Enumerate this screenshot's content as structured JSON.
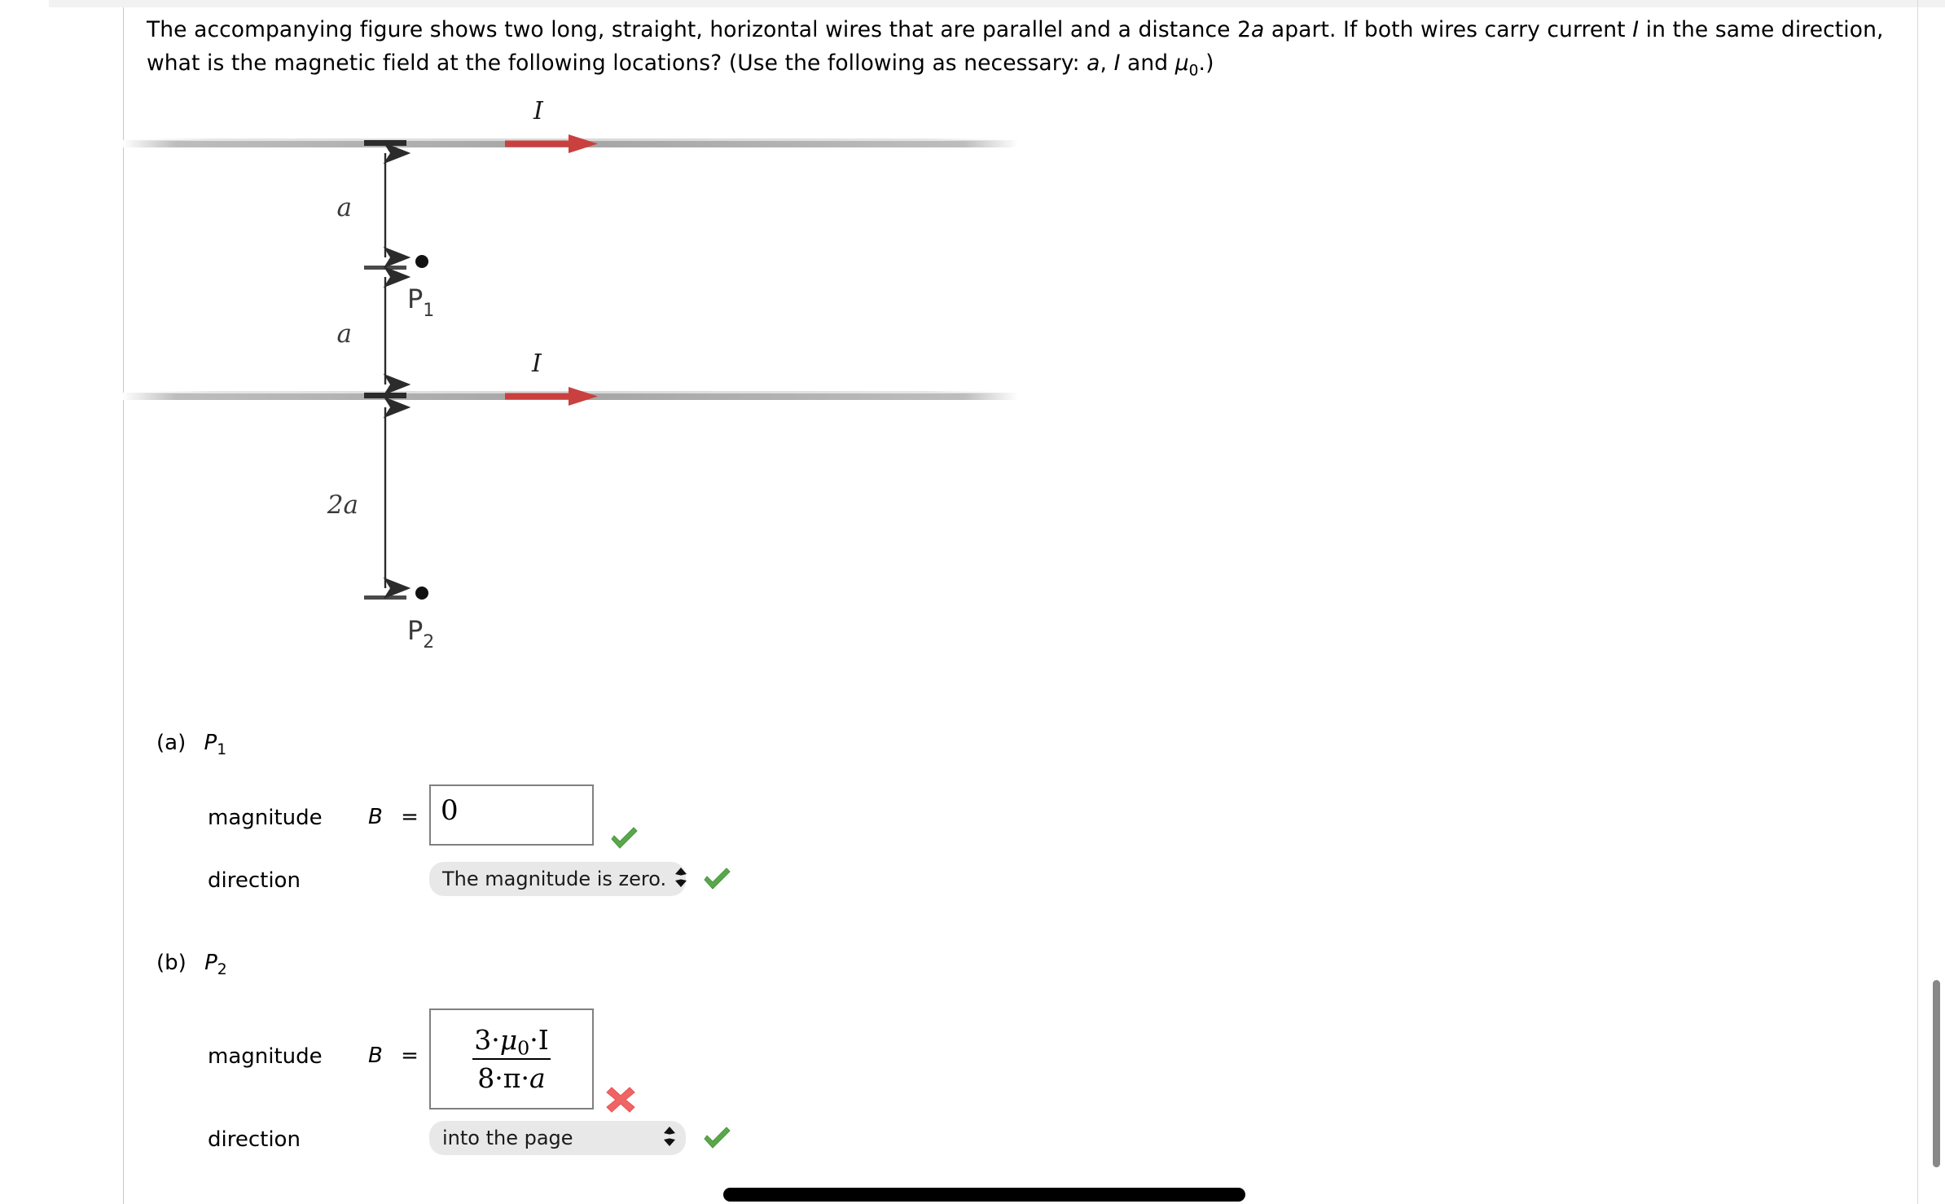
{
  "question": {
    "line1_a": "The accompanying figure shows two long, straight, horizontal wires that are parallel and a distance 2",
    "line1_b": "a",
    "line1_c": " apart. If both wires carry current ",
    "line1_d": "I",
    "line1_e": " in the same direction,",
    "line2_a": "what is the magnetic field at the following locations? (Use the following as necessary: ",
    "line2_b": "a",
    "line2_c": ", ",
    "line2_d": "I",
    "line2_e": " and ",
    "line2_mu": "μ",
    "line2_mu_sub": "0",
    "line2_f": ".)"
  },
  "figure": {
    "current_label_top": "I",
    "current_label_bottom": "I",
    "dim_a_top": "a",
    "dim_a_bottom": "a",
    "dim_2a": "2a",
    "point1_label": "P",
    "point1_sub": "1",
    "point2_label": "P",
    "point2_sub": "2",
    "wire_color": "#a8a8a8",
    "arrow_color": "#c9403f",
    "dim_line_color": "#3a3a3a"
  },
  "parts": [
    {
      "tag": "(a)",
      "point": "P",
      "point_sub": "1",
      "magnitude_label": "magnitude",
      "b_symbol": "B",
      "equals": "=",
      "answer_type": "plain",
      "answer_value": "0",
      "magnitude_status": "correct",
      "direction_label": "direction",
      "direction_value": "The magnitude is zero.",
      "direction_status": "correct"
    },
    {
      "tag": "(b)",
      "point": "P",
      "point_sub": "2",
      "magnitude_label": "magnitude",
      "b_symbol": "B",
      "equals": "=",
      "answer_type": "fraction",
      "answer_numerator": "3 · μ₀ · I",
      "answer_denominator": "8 · π · a",
      "num_parts": {
        "c1": "3",
        "dot1": "·",
        "mu": "μ",
        "mu_sub": "0",
        "dot2": "·",
        "cur": "I"
      },
      "den_parts": {
        "c1": "8",
        "dot1": "·",
        "pi": "π",
        "dot2": "·",
        "a": "a"
      },
      "magnitude_status": "incorrect",
      "direction_label": "direction",
      "direction_value": "into the page",
      "direction_status": "correct"
    }
  ],
  "icons": {
    "check": "check-mark-icon",
    "cross": "cross-mark-icon",
    "chevron": "⌃⌄"
  },
  "colors": {
    "check_green": "#5aa84a",
    "cross_red": "#f06464",
    "select_bg": "#e8e8e8",
    "input_border": "#808080"
  }
}
